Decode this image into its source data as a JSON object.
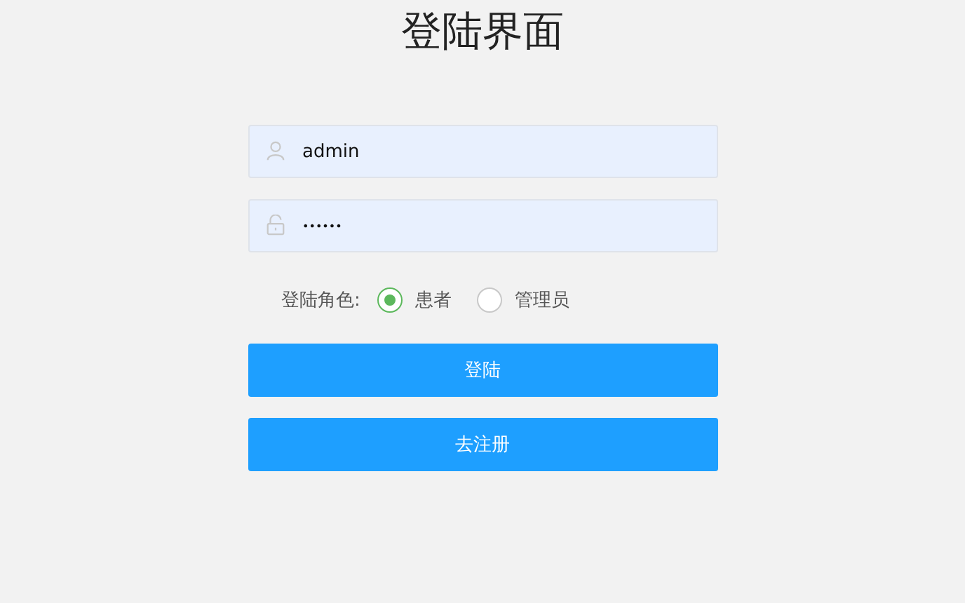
{
  "title": "登陆界面",
  "username": {
    "value": "admin"
  },
  "password": {
    "value": "••••••"
  },
  "role": {
    "label": "登陆角色:",
    "options": [
      {
        "label": "患者",
        "selected": true
      },
      {
        "label": "管理员",
        "selected": false
      }
    ]
  },
  "buttons": [
    "登陆",
    "去注册"
  ]
}
